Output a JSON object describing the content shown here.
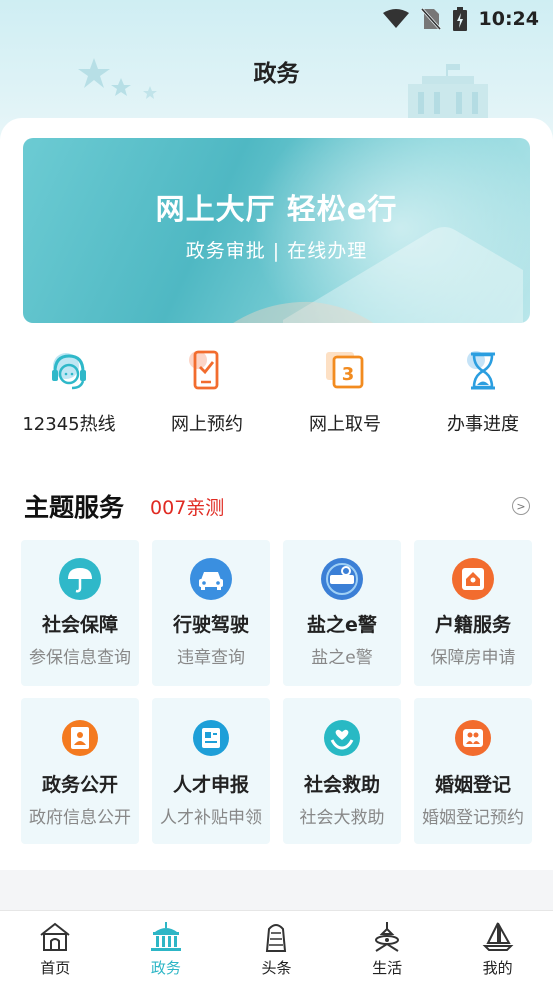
{
  "status_bar": {
    "time": "10:24"
  },
  "header": {
    "title": "政务"
  },
  "banner": {
    "headline": "网上大厅 轻松e行",
    "subline": "政务审批 | 在线办理"
  },
  "quick_actions": [
    {
      "label": "12345热线",
      "icon": "headset-icon"
    },
    {
      "label": "网上预约",
      "icon": "phone-check-icon"
    },
    {
      "label": "网上取号",
      "icon": "ticket-number-icon"
    },
    {
      "label": "办事进度",
      "icon": "hourglass-icon"
    }
  ],
  "theme_services": {
    "title": "主题服务",
    "tag": "007亲测",
    "tiles": [
      {
        "title": "社会保障",
        "subtitle": "参保信息查询",
        "icon": "umbrella-icon",
        "color": "#2fb8c9"
      },
      {
        "title": "行驶驾驶",
        "subtitle": "违章查询",
        "icon": "car-icon",
        "color": "#3a8fe0"
      },
      {
        "title": "盐之e警",
        "subtitle": "盐之e警",
        "icon": "police-badge-icon",
        "color": "#3b7fd6"
      },
      {
        "title": "户籍服务",
        "subtitle": "保障房申请",
        "icon": "house-icon",
        "color": "#f26c2e"
      },
      {
        "title": "政务公开",
        "subtitle": "政府信息公开",
        "icon": "person-icon",
        "color": "#f47a1f"
      },
      {
        "title": "人才申报",
        "subtitle": "人才补贴申领",
        "icon": "id-card-icon",
        "color": "#1e9fd8"
      },
      {
        "title": "社会救助",
        "subtitle": "社会大救助",
        "icon": "helping-hands-icon",
        "color": "#28b9c4"
      },
      {
        "title": "婚姻登记",
        "subtitle": "婚姻登记预约",
        "icon": "couple-icon",
        "color": "#f26c2e"
      }
    ]
  },
  "bottom_nav": [
    {
      "label": "首页",
      "icon": "home-icon",
      "active": false
    },
    {
      "label": "政务",
      "icon": "government-building-icon",
      "active": true
    },
    {
      "label": "头条",
      "icon": "headlines-icon",
      "active": false
    },
    {
      "label": "生活",
      "icon": "tower-icon",
      "active": false
    },
    {
      "label": "我的",
      "icon": "sailboat-icon",
      "active": false
    }
  ],
  "colors": {
    "accent": "#2db6c6",
    "tag_red": "#e02a22"
  }
}
